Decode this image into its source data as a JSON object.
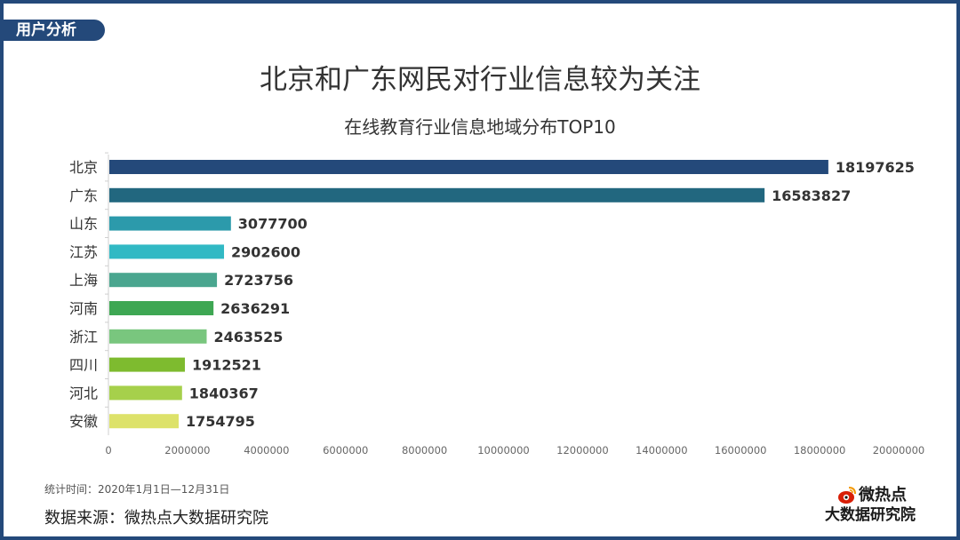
{
  "section_tag": "用户分析",
  "main_title": "北京和广东网民对行业信息较为关注",
  "chart_data": {
    "type": "bar",
    "orientation": "horizontal",
    "title": "在线教育行业信息地域分布TOP10",
    "categories": [
      "北京",
      "广东",
      "山东",
      "江苏",
      "上海",
      "河南",
      "浙江",
      "四川",
      "河北",
      "安徽"
    ],
    "values": [
      18197625,
      16583827,
      3077700,
      2902600,
      2723756,
      2636291,
      2463525,
      1912521,
      1840367,
      1754795
    ],
    "colors": [
      "#24497a",
      "#22677f",
      "#2c9aab",
      "#31b9c4",
      "#4aa68f",
      "#3ea753",
      "#79c67e",
      "#7ebb2f",
      "#a6d04b",
      "#dde26a"
    ],
    "xlim": [
      0,
      20000000
    ],
    "x_ticks": [
      "0",
      "2000000",
      "4000000",
      "6000000",
      "8000000",
      "10000000",
      "12000000",
      "14000000",
      "16000000",
      "18000000",
      "20000000"
    ],
    "data_labels": [
      "18197625",
      "16583827",
      "3077700",
      "2902600",
      "2723756",
      "2636291",
      "2463525",
      "1912521",
      "1840367",
      "1754795"
    ],
    "grid": false,
    "legend": "none"
  },
  "footer": {
    "period": "统计时间：2020年1月1日—12月31日",
    "source": "数据来源：微热点大数据研究院"
  },
  "brand": {
    "name": "微热点",
    "subtitle": "大数据研究院",
    "icon": "weibo-eye-icon"
  }
}
